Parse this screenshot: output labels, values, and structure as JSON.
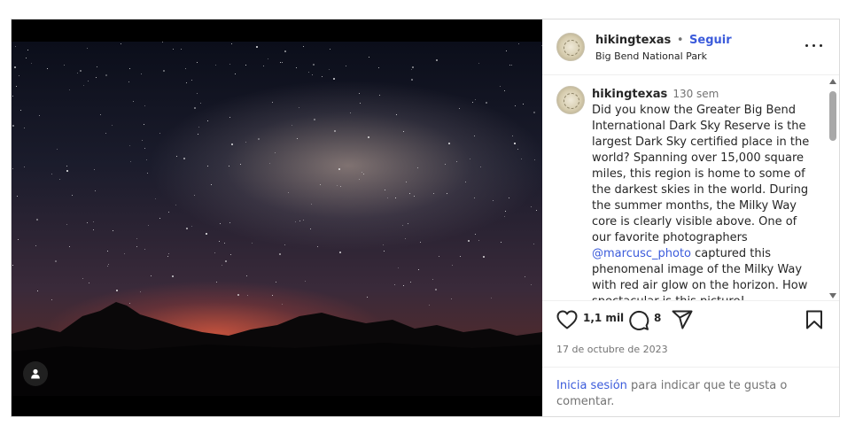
{
  "colors": {
    "link": "#3b5bdb",
    "text": "#262626",
    "muted": "#737373",
    "border": "#dbdbdb"
  },
  "media": {
    "user_tag_icon": "person-icon"
  },
  "header": {
    "username": "hikingtexas",
    "separator": "•",
    "follow_label": "Seguir",
    "location": "Big Bend National Park",
    "more_icon": "more-options-icon"
  },
  "caption": {
    "username": "hikingtexas",
    "time": "130 sem",
    "text_before_mention": "Did you know the Greater Big Bend International Dark Sky Reserve is the largest Dark Sky certified place in the world? Spanning over 15,000 square miles, this region is home to some of the darkest skies in the world. During the summer months, the Milky Way core is clearly visible above. One of our favorite photographers",
    "mention": "@marcusc_photo",
    "text_after_mention": "captured this phenomenal image of the Milky Way with red air glow on the horizon. How spectacular is this picture!"
  },
  "actions": {
    "like_icon": "heart-icon",
    "like_count": "1,1 mil",
    "comment_icon": "comment-icon",
    "comment_count": "8",
    "share_icon": "send-icon",
    "save_icon": "bookmark-icon"
  },
  "date": "17 de octubre de 2023",
  "login_prompt": {
    "link": "Inicia sesión",
    "rest": "para indicar que te gusta o comentar."
  }
}
